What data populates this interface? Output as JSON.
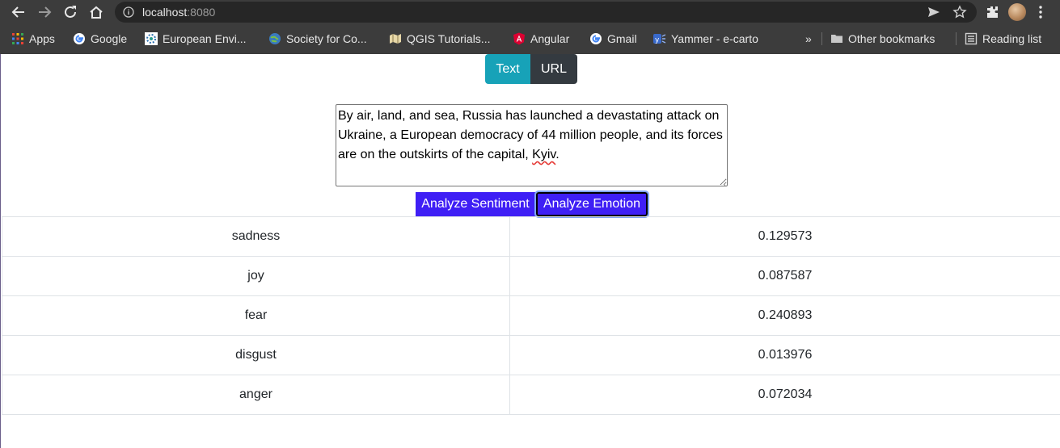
{
  "browser": {
    "url_host": "localhost",
    "url_port": ":8080",
    "bookmarks": [
      {
        "label": "Apps",
        "icon": "apps-grid-icon"
      },
      {
        "label": "Google",
        "icon": "google-icon"
      },
      {
        "label": "European Envi...",
        "icon": "eea-icon"
      },
      {
        "label": "Society for Co...",
        "icon": "globe-icon"
      },
      {
        "label": "QGIS Tutorials...",
        "icon": "qgis-icon"
      },
      {
        "label": "Angular",
        "icon": "angular-icon"
      },
      {
        "label": "Gmail",
        "icon": "google-icon"
      },
      {
        "label": "Yammer - e-carto",
        "icon": "yammer-icon"
      }
    ],
    "overflow_label": "»",
    "other_bookmarks": "Other bookmarks",
    "reading_list": "Reading list"
  },
  "app": {
    "tabs": {
      "text": "Text",
      "url": "URL"
    },
    "input": {
      "text_before": "By air, land, and sea, Russia has launched a devastating attack on Ukraine, a European democracy of 44 million people, and its forces are on the outskirts of the capital, ",
      "text_flagged": "Kyiv",
      "text_after": "."
    },
    "buttons": {
      "sentiment": "Analyze Sentiment",
      "emotion": "Analyze Emotion"
    },
    "results": [
      {
        "emotion": "sadness",
        "score": "0.129573"
      },
      {
        "emotion": "joy",
        "score": "0.087587"
      },
      {
        "emotion": "fear",
        "score": "0.240893"
      },
      {
        "emotion": "disgust",
        "score": "0.013976"
      },
      {
        "emotion": "anger",
        "score": "0.072034"
      }
    ]
  },
  "colors": {
    "chrome_bg": "#3c3c3c",
    "tab_text_active": "#17a2b8",
    "tab_url": "#343a40",
    "analyze_button": "#3f1ff5"
  }
}
